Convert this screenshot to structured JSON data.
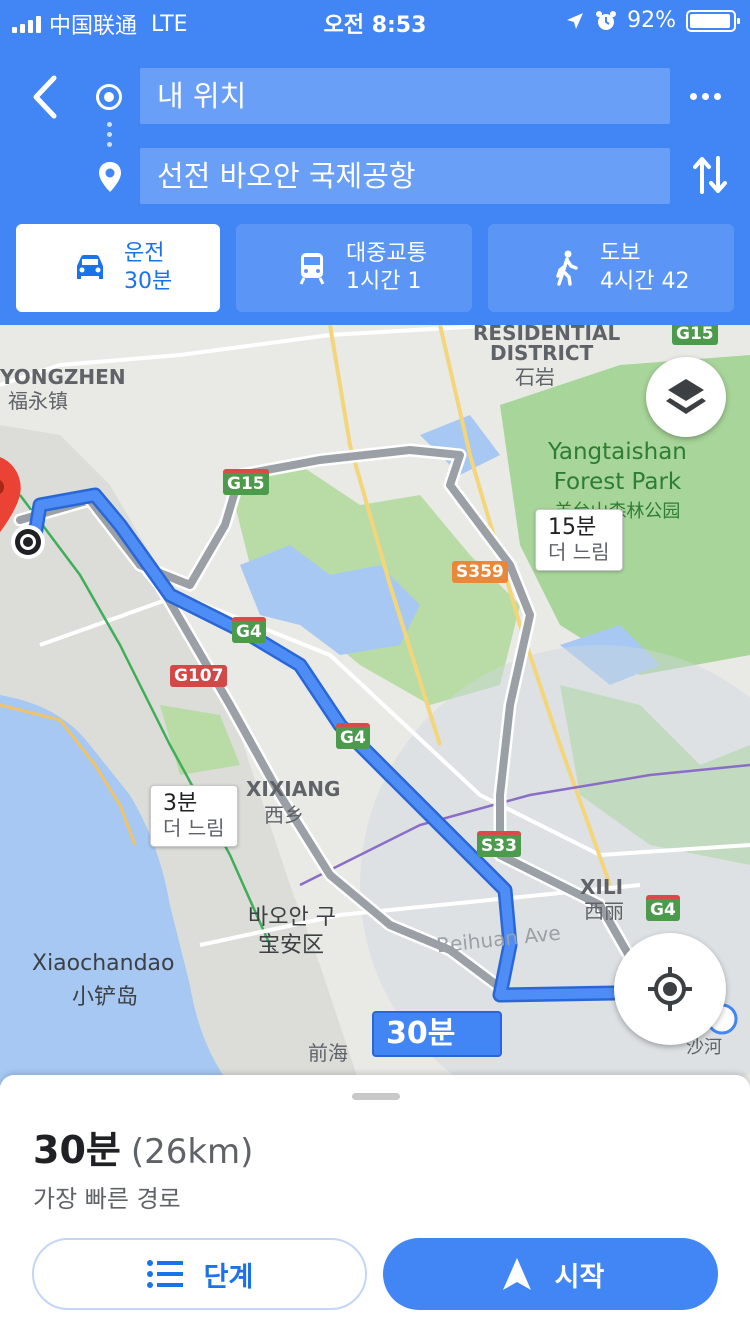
{
  "status_bar": {
    "carrier": "中国联通",
    "network": "LTE",
    "time": "오전 8:53",
    "battery": "92%"
  },
  "search": {
    "origin": "내 위치",
    "destination": "선전 바오안 국제공항"
  },
  "modes": [
    {
      "label": "운전",
      "time": "30분",
      "icon": "car-icon"
    },
    {
      "label": "대중교통",
      "time": "1시간 1",
      "icon": "bus-icon"
    },
    {
      "label": "도보",
      "time": "4시간 42",
      "icon": "walk-icon"
    }
  ],
  "map": {
    "labels": {
      "residential": "RESIDENTIAL",
      "district": "DISTRICT",
      "shiyan": "石岩",
      "yongzhen": "YONGZHEN",
      "fuyongzhen": "福永镇",
      "park_en_1": "Yangtaishan",
      "park_en_2": "Forest Park",
      "park_cn": "羊台山森林公园",
      "xixiang": "XIXIANG",
      "xixiang_cn": "西乡",
      "baoan_kr": "바오안 구",
      "baoan_cn": "宝安区",
      "xiaochandao": "Xiaochandao",
      "xiaochandao_cn": "小铲岛",
      "beihuan": "Beihuan Ave",
      "xili": "XILI",
      "xili_cn": "西丽",
      "qianhai": "前海",
      "shahe": "沙河"
    },
    "shields": {
      "g15a": "G15",
      "g15b": "G15",
      "g4a": "G4",
      "g4b": "G4",
      "g4c": "G4",
      "g107": "G107",
      "s359": "S359",
      "s33": "S33"
    },
    "callouts": {
      "alt1_time": "15분",
      "alt1_note": "더 느림",
      "alt2_time": "3분",
      "alt2_note": "더 느림",
      "main_time": "30분"
    }
  },
  "sheet": {
    "time": "30분",
    "distance": "(26km)",
    "subtitle": "가장 빠른 경로",
    "steps_label": "단계",
    "start_label": "시작"
  },
  "colors": {
    "header": "#4285f4",
    "route": "#4285f4",
    "alt_route": "#9aa0a6",
    "park": "#a8d59a",
    "water": "#a6c8f3"
  }
}
